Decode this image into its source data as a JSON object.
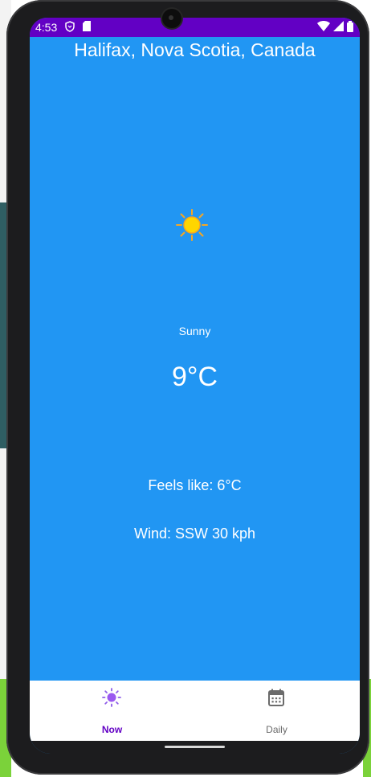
{
  "status_bar": {
    "time": "4:53",
    "left_icons": [
      "shield-icon",
      "sd-card-icon"
    ],
    "right_icons": [
      "wifi-icon",
      "signal-icon",
      "battery-icon"
    ]
  },
  "weather": {
    "location": "Halifax, Nova Scotia, Canada",
    "icon": "sun-icon",
    "condition": "Sunny",
    "temperature": "9°C",
    "feels_like": "Feels like: 6°C",
    "wind": "Wind: SSW 30 kph"
  },
  "bottom_nav": {
    "items": [
      {
        "label": "Now",
        "icon": "sun-icon",
        "selected": true
      },
      {
        "label": "Daily",
        "icon": "calendar-icon",
        "selected": false
      }
    ]
  },
  "colors": {
    "status_bar": "#6200c4",
    "screen_bg": "#2196f3",
    "nav_selected": "#6200c4",
    "nav_unselected": "#6b6b6b",
    "sun": "#ffc107"
  }
}
